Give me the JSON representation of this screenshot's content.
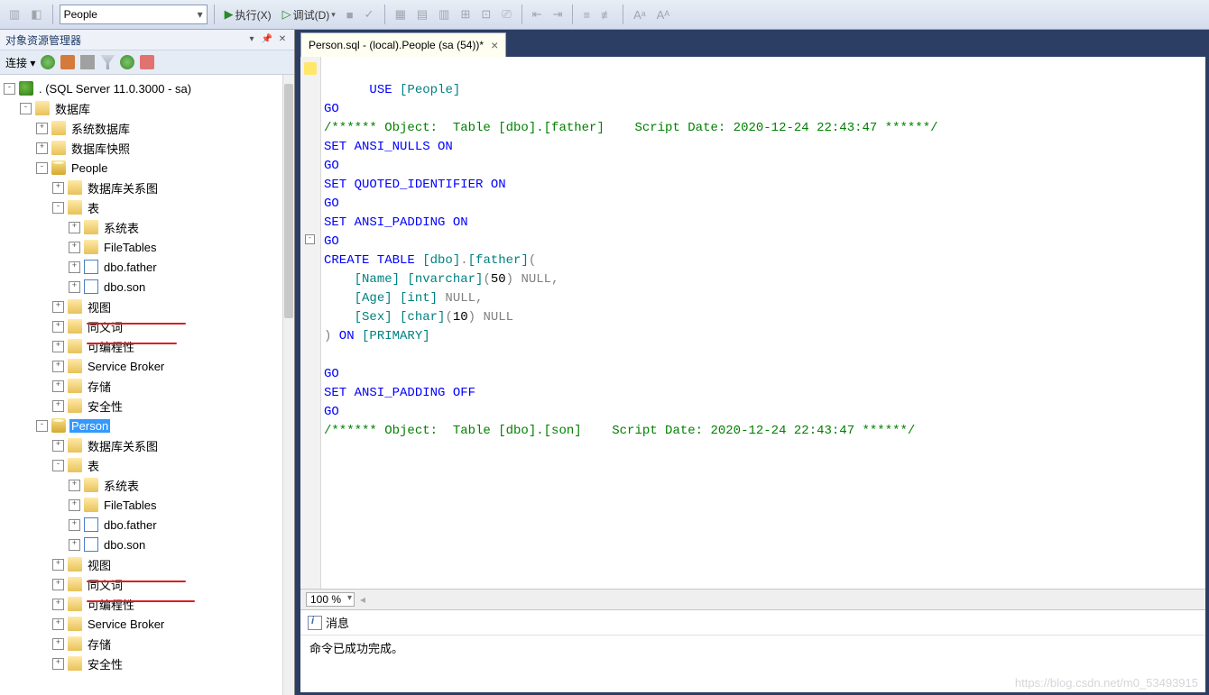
{
  "toolbar": {
    "combo_value": "People",
    "execute_label": "执行(X)",
    "debug_label": "调试(D)"
  },
  "explorer": {
    "title": "对象资源管理器",
    "connect_label": "连接 ▾",
    "server_label": ". (SQL Server 11.0.3000 - sa)",
    "databases_label": "数据库",
    "system_db_label": "系统数据库",
    "db_snapshot_label": "数据库快照",
    "people_label": "People",
    "person_label": "Person",
    "db_diagrams_label": "数据库关系图",
    "tables_label": "表",
    "system_tables_label": "系统表",
    "filetables_label": "FileTables",
    "tbl_father_label": "dbo.father",
    "tbl_son_label": "dbo.son",
    "views_label": "视图",
    "synonyms_label": "同义词",
    "programmability_label": "可编程性",
    "service_broker_label": "Service Broker",
    "storage_label": "存储",
    "security_label": "安全性"
  },
  "editor": {
    "tab_title": "Person.sql - (local).People (sa (54))*",
    "zoom": "100 %",
    "code_lines": [
      {
        "t": "USE ",
        "cls": "kw"
      },
      {
        "t": "[People]",
        "cls": "ident"
      },
      {
        "t": "\n"
      },
      {
        "t": "GO\n",
        "cls": "kw"
      },
      {
        "t": "/****** Object:  Table [dbo].[father]    Script Date: 2020-12-24 22:43:47 ******/\n",
        "cls": "cm"
      },
      {
        "t": "SET ANSI_NULLS ON\n",
        "cls": "kw"
      },
      {
        "t": "GO\n",
        "cls": "kw"
      },
      {
        "t": "SET QUOTED_IDENTIFIER ON\n",
        "cls": "kw"
      },
      {
        "t": "GO\n",
        "cls": "kw"
      },
      {
        "t": "SET ANSI_PADDING ON\n",
        "cls": "kw"
      },
      {
        "t": "GO\n",
        "cls": "kw"
      },
      {
        "t": "CREATE TABLE ",
        "cls": "kw"
      },
      {
        "t": "[dbo]",
        "cls": "ident"
      },
      {
        "t": ".",
        "cls": "gray"
      },
      {
        "t": "[father]",
        "cls": "ident"
      },
      {
        "t": "(",
        "cls": "gray"
      },
      {
        "t": "\n"
      },
      {
        "t": "    ",
        "cls": ""
      },
      {
        "t": "[Name] [nvarchar]",
        "cls": "ident"
      },
      {
        "t": "(",
        "cls": "gray"
      },
      {
        "t": "50",
        "cls": "num"
      },
      {
        "t": ")",
        "cls": "gray"
      },
      {
        "t": " NULL",
        "cls": "gray"
      },
      {
        "t": ",",
        "cls": "gray"
      },
      {
        "t": "\n"
      },
      {
        "t": "    ",
        "cls": ""
      },
      {
        "t": "[Age] [int]",
        "cls": "ident"
      },
      {
        "t": " NULL",
        "cls": "gray"
      },
      {
        "t": ",",
        "cls": "gray"
      },
      {
        "t": "\n"
      },
      {
        "t": "    ",
        "cls": ""
      },
      {
        "t": "[Sex] [char]",
        "cls": "ident"
      },
      {
        "t": "(",
        "cls": "gray"
      },
      {
        "t": "10",
        "cls": "num"
      },
      {
        "t": ")",
        "cls": "gray"
      },
      {
        "t": " NULL",
        "cls": "gray"
      },
      {
        "t": "\n"
      },
      {
        "t": ")",
        "cls": "gray"
      },
      {
        "t": " ON ",
        "cls": "kw"
      },
      {
        "t": "[PRIMARY]",
        "cls": "ident"
      },
      {
        "t": "\n"
      },
      {
        "t": "\n"
      },
      {
        "t": "GO\n",
        "cls": "kw"
      },
      {
        "t": "SET ANSI_PADDING OFF\n",
        "cls": "kw"
      },
      {
        "t": "GO\n",
        "cls": "kw"
      },
      {
        "t": "/****** Object:  Table [dbo].[son]    Script Date: 2020-12-24 22:43:47 ******/",
        "cls": "cm"
      }
    ]
  },
  "messages": {
    "tab_label": "消息",
    "body_text": "命令已成功完成。"
  },
  "watermark": "https://blog.csdn.net/m0_53493915"
}
